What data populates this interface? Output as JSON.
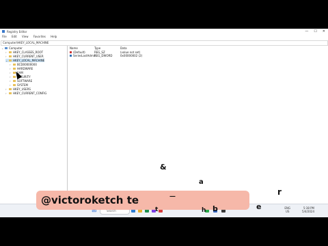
{
  "window": {
    "title": "Registry Editor",
    "controls": [
      "—",
      "☐",
      "✕"
    ]
  },
  "menu": [
    "File",
    "Edit",
    "View",
    "Favorites",
    "Help"
  ],
  "address": "Computer\\HKEY_LOCAL_MACHINE",
  "tree": {
    "root": "Computer",
    "hives": [
      "HKEY_CLASSES_ROOT",
      "HKEY_CURRENT_USER",
      "HKEY_LOCAL_MACHINE",
      "HKEY_USERS",
      "HKEY_CURRENT_CONFIG"
    ],
    "selected": "HKEY_LOCAL_MACHINE",
    "hklm_children": [
      "BCD00000000",
      "HARDWARE",
      "SAM",
      "SECURITY",
      "SOFTWARE",
      "SYSTEM"
    ]
  },
  "values_header": [
    "Name",
    "Type",
    "Data"
  ],
  "values": [
    {
      "name": "(Default)",
      "type": "REG_SZ",
      "data": "(value not set)",
      "icon": "string-icon"
    },
    {
      "name": "SeriesLastAdmin",
      "type": "REG_DWORD",
      "data": "0x00000002 (2)",
      "icon": "binary-icon"
    }
  ],
  "taskbar": {
    "search_placeholder": "Search",
    "lang": "ENG",
    "region": "US",
    "time": "5:38 PM",
    "date": "5/4/2024"
  },
  "overlay": {
    "banner_text": "@victoroketch te",
    "floating_chars": [
      "&",
      "a",
      "r",
      "e",
      "b",
      "h",
      "t",
      "—"
    ]
  }
}
